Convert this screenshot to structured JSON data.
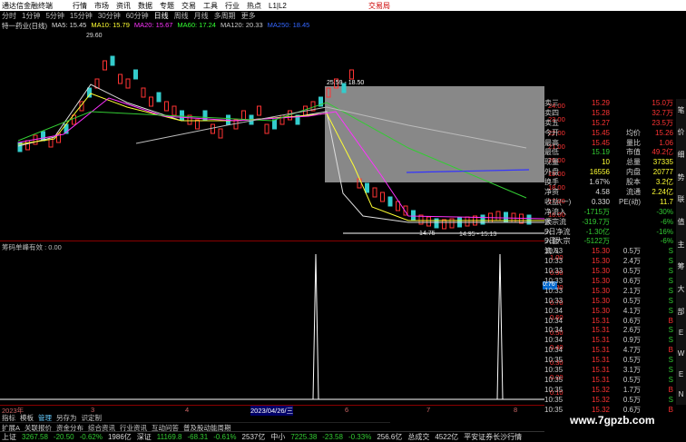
{
  "titlebar": {
    "app": "通达信金融终端",
    "menus": [
      "行情",
      "市场",
      "资讯",
      "数据",
      "专题",
      "交易",
      "工具",
      "行业",
      "热点",
      "L1|L2"
    ],
    "right": "交易局"
  },
  "toolbar": {
    "items": [
      "分时",
      "1分钟",
      "5分钟",
      "15分钟",
      "30分钟",
      "60分钟",
      "日线",
      "周线",
      "月线",
      "多周期",
      "更多"
    ],
    "selected": "日线"
  },
  "legend": {
    "name": "特一药业(日线)",
    "ma5": "MA5: 15.45",
    "ma10": "MA10: 15.79",
    "ma20": "MA20: 15.67",
    "ma60": "MA60: 17.24",
    "ma120": "MA120: 20.33",
    "ma250": "MA250: 18.45"
  },
  "annotations": {
    "high1": "29.60",
    "range1": "25.59 - 18.50",
    "low1": "14.75",
    "range2": "14.95 - 15.13"
  },
  "price_axis": [
    "24.00",
    "23.00",
    "22.00",
    "21.00",
    "20.00",
    "19.00",
    "18.00",
    "17.00",
    "16.00"
  ],
  "indicator": {
    "title": "筹码单峰有效 : 0.00",
    "axis": [
      "1.00",
      "0.90",
      "0.80",
      "0.70",
      "0.60",
      "0.50",
      "0.40",
      "0.30",
      "0.20",
      "0.10"
    ],
    "cursor_value": "0.76"
  },
  "timeaxis": {
    "labels": [
      "2023年",
      "3",
      "4",
      "2023/04/26/三",
      "6",
      "7",
      "8"
    ]
  },
  "bottom1": [
    "指标",
    "模板",
    "管理",
    "另存为",
    "识定制"
  ],
  "bottom2": [
    "扩展A",
    "关联报价",
    "资金分布",
    "综合资讯",
    "行业资讯",
    "互动问答",
    "普及股动能周期"
  ],
  "orderbook": [
    {
      "a": "卖三",
      "b": "15.29",
      "c": "15.0万",
      "bc": "up"
    },
    {
      "a": "卖四",
      "b": "15.28",
      "c": "32.7万",
      "bc": "up"
    },
    {
      "a": "卖五",
      "b": "15.27",
      "c": "23.5万",
      "bc": "up"
    }
  ],
  "stats": [
    {
      "a": "今开",
      "b": "15.45",
      "c": "均价",
      "d": "15.26"
    },
    {
      "a": "最高",
      "b": "15.45",
      "c": "量比",
      "d": "1.06"
    },
    {
      "a": "最低",
      "b": "15.19",
      "c": "市值",
      "d": "49.2亿"
    },
    {
      "a": "现量",
      "b": "10",
      "c": "总量",
      "d": "37335"
    },
    {
      "a": "外盘",
      "b": "16556",
      "c": "内盘",
      "d": "20777"
    },
    {
      "a": "换手",
      "b": "1.67%",
      "c": "股本",
      "d": "3.2亿"
    },
    {
      "a": "净资",
      "b": "4.58",
      "c": "流通",
      "d": "2.24亿"
    },
    {
      "a": "收益(一)",
      "b": "0.330",
      "c": "PE(动)",
      "d": "11.7"
    }
  ],
  "flows": [
    {
      "a": "净流入额",
      "b": "-1715万",
      "d": "-30%"
    },
    {
      "a": "大宗流入",
      "b": "-319.7万",
      "d": "-6%"
    },
    {
      "a": "5日净流入额",
      "b": "-1.30亿",
      "d": "-16%"
    },
    {
      "a": "5日大宗流入",
      "b": "-5122万",
      "d": "-6%"
    }
  ],
  "trades": [
    {
      "t": "10:33",
      "p": "15.30",
      "v": "0.5万",
      "s": "S"
    },
    {
      "t": "10:33",
      "p": "15.30",
      "v": "2.4万",
      "s": "S"
    },
    {
      "t": "10:33",
      "p": "15.30",
      "v": "0.5万",
      "s": "S"
    },
    {
      "t": "10:33",
      "p": "15.30",
      "v": "0.6万",
      "s": "S"
    },
    {
      "t": "10:33",
      "p": "15.30",
      "v": "2.1万",
      "s": "S"
    },
    {
      "t": "10:33",
      "p": "15.30",
      "v": "0.5万",
      "s": "S"
    },
    {
      "t": "10:34",
      "p": "15.30",
      "v": "4.1万",
      "s": "S"
    },
    {
      "t": "10:34",
      "p": "15.31",
      "v": "0.6万",
      "s": "B"
    },
    {
      "t": "10:34",
      "p": "15.31",
      "v": "2.6万",
      "s": "S"
    },
    {
      "t": "10:34",
      "p": "15.31",
      "v": "0.9万",
      "s": "S"
    },
    {
      "t": "10:34",
      "p": "15.31",
      "v": "4.7万",
      "s": "B"
    },
    {
      "t": "10:35",
      "p": "15.31",
      "v": "0.5万",
      "s": "S"
    },
    {
      "t": "10:35",
      "p": "15.31",
      "v": "3.1万",
      "s": "S"
    },
    {
      "t": "10:35",
      "p": "15.31",
      "v": "0.5万",
      "s": "S"
    },
    {
      "t": "10:35",
      "p": "15.32",
      "v": "1.7万",
      "s": "B"
    },
    {
      "t": "10:35",
      "p": "15.32",
      "v": "0.5万",
      "s": "S"
    },
    {
      "t": "10:35",
      "p": "15.32",
      "v": "0.6万",
      "s": "B"
    }
  ],
  "sidebar": [
    "笔",
    "价",
    "细",
    "势",
    "联",
    "值",
    "主",
    "筹",
    "大",
    "部",
    "E",
    "W",
    "E",
    "N"
  ],
  "status": {
    "sh_name": "上证",
    "sh_val": "3267.58",
    "sh_chg": "-20.50",
    "sh_pct": "-0.62%",
    "sh_amt": "1986亿",
    "sz_name": "深证",
    "sz_val": "11169.8",
    "sz_chg": "-68.31",
    "sz_pct": "-0.61%",
    "sz_amt": "2537亿",
    "zx_name": "中小",
    "zx_val": "7225.38",
    "zx_chg": "-23.58",
    "zx_pct": "-0.33%",
    "zx_amt": "256.6亿",
    "tail1": "总成交",
    "tail2": "4522亿",
    "tail3": "平安证券长沙行情"
  },
  "watermark": "www.7gpzb.com"
}
